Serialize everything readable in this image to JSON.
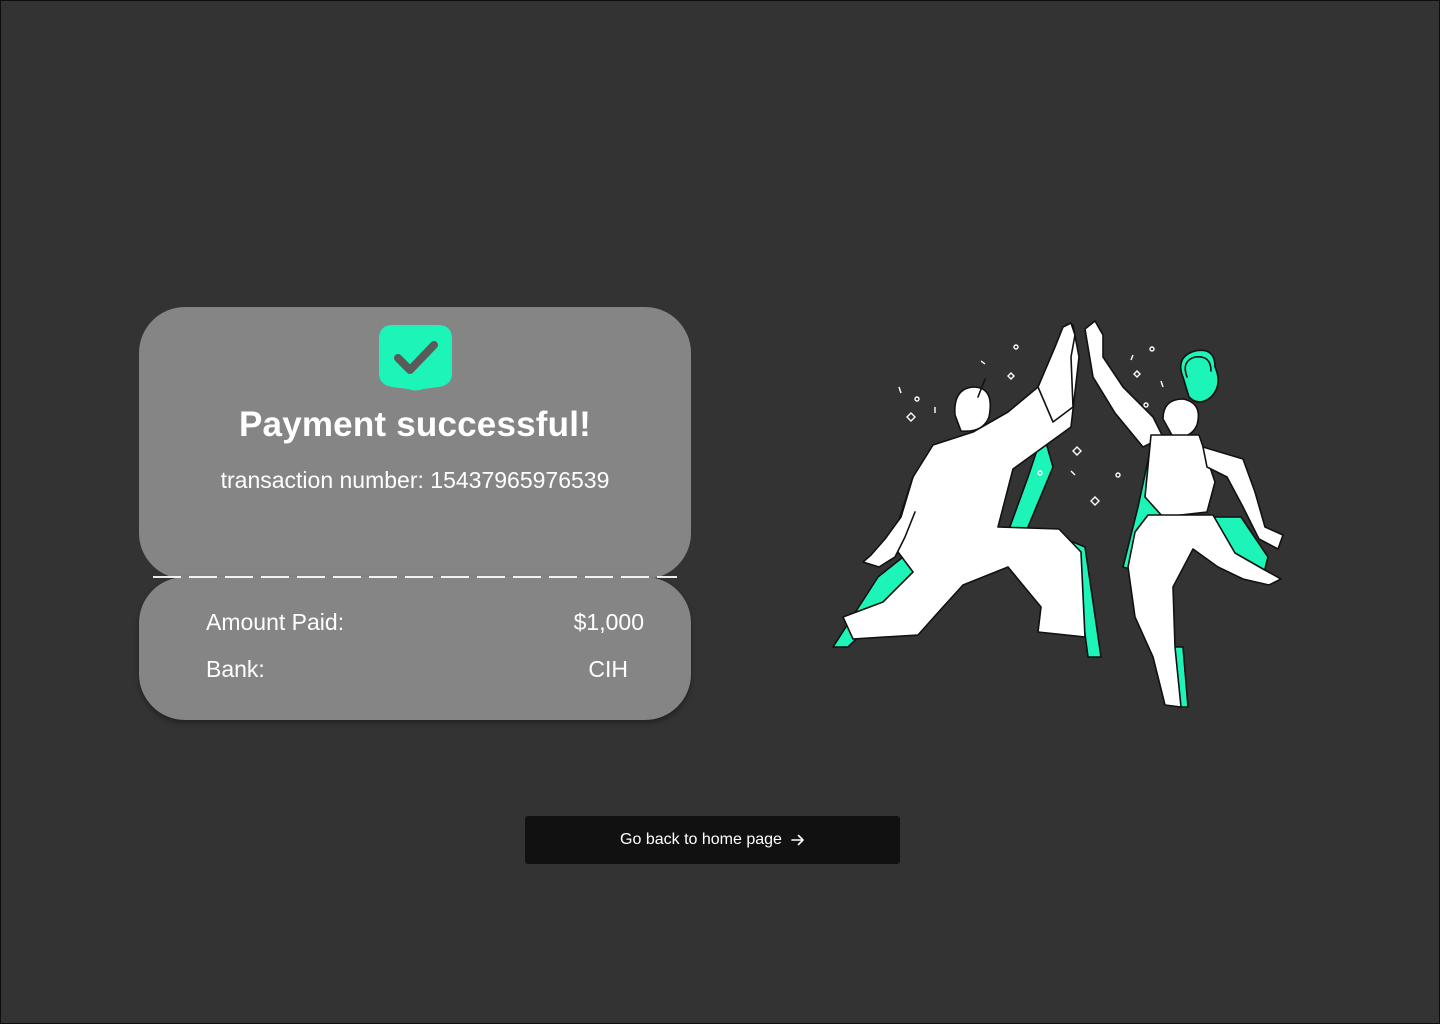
{
  "receipt": {
    "title": "Payment successful!",
    "transaction_label": "transaction number:",
    "transaction_number": "15437965976539",
    "amount_label": "Amount Paid:",
    "amount_value": "$1,000",
    "bank_label": "Bank:",
    "bank_value": "CIH",
    "status_icon": "check-badge-icon"
  },
  "actions": {
    "home_button_label": "Go back to home page",
    "home_button_icon": "arrow-right-icon"
  },
  "colors": {
    "background": "#333333",
    "card": "#858585",
    "accent": "#1DF5B8",
    "button": "#111111",
    "text": "#FFFFFF"
  }
}
